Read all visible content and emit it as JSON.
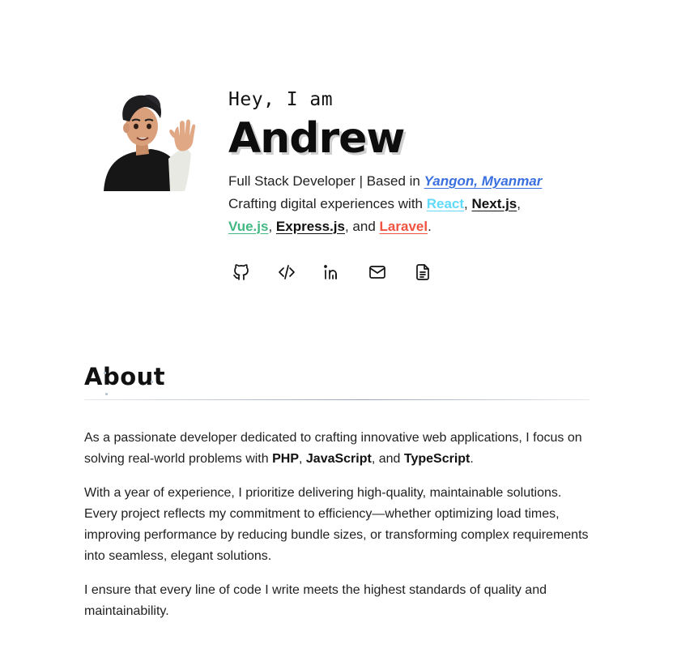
{
  "hero": {
    "greeting": "Hey, I am",
    "name": "Andrew",
    "bio_line1_prefix": "Full Stack Developer | Based in ",
    "location": "Yangon, Myanmar",
    "bio_line2_prefix": "Crafting digital experiences with ",
    "tech": {
      "react": "React",
      "nextjs": "Next.js",
      "vuejs": "Vue.js",
      "expressjs": "Express.js",
      "laravel": "Laravel"
    },
    "sep_comma": ",",
    "and_text": ", and ",
    "period": "."
  },
  "socials": [
    {
      "icon": "github-icon"
    },
    {
      "icon": "code-icon"
    },
    {
      "icon": "linkedin-icon"
    },
    {
      "icon": "mail-icon"
    },
    {
      "icon": "resume-icon"
    }
  ],
  "about": {
    "title": "About",
    "p1_text1": "As a passionate developer dedicated to crafting innovative web applications, I focus on solving real-world problems with ",
    "p1_php": "PHP",
    "p1_sep": ", ",
    "p1_js": "JavaScript",
    "p1_and": ", and ",
    "p1_ts": "TypeScript",
    "p1_end": ".",
    "p2": "With a year of experience, I prioritize delivering high-quality, maintainable solutions. Every project reflects my commitment to efficiency—whether optimizing load times, improving performance by reducing bundle sizes, or transforming complex requirements into seamless, elegant solutions.",
    "p3": "I ensure that every line of code I write meets the highest standards of quality and maintainability."
  },
  "colors": {
    "location": "#3a6fe0",
    "react": "#61dafb",
    "vue": "#42b883",
    "laravel": "#f05340"
  }
}
